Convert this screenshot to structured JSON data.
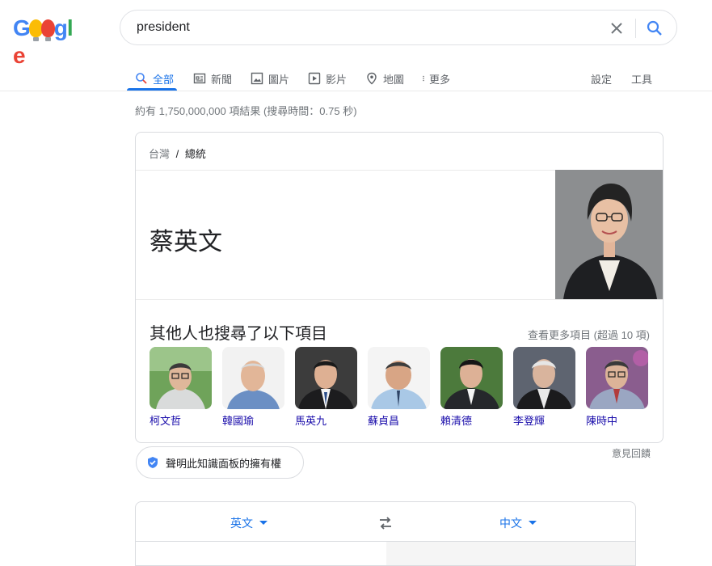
{
  "search": {
    "query": "president"
  },
  "tabs": [
    {
      "label": "全部",
      "icon": "search-icon"
    },
    {
      "label": "新聞",
      "icon": "news-icon"
    },
    {
      "label": "圖片",
      "icon": "image-icon"
    },
    {
      "label": "影片",
      "icon": "video-icon"
    },
    {
      "label": "地圖",
      "icon": "map-pin-icon"
    },
    {
      "label": "更多",
      "icon": "more-vert-icon"
    }
  ],
  "tools": {
    "settings": "設定",
    "tools": "工具"
  },
  "result_stats": "約有 1,750,000,000 項結果 (搜尋時間：0.75 秒)",
  "panel": {
    "breadcrumb": {
      "parent": "台灣",
      "separator": "/",
      "current": "總統"
    },
    "title": "蔡英文",
    "also_search": {
      "heading": "其他人也搜尋了以下項目",
      "see_more": "查看更多項目 (超過 10 項)",
      "people": [
        "柯文哲",
        "韓國瑜",
        "馬英九",
        "蘇貞昌",
        "賴清德",
        "李登輝",
        "陳時中"
      ]
    }
  },
  "feedback": "意見回饋",
  "claim": "聲明此知識面板的擁有權",
  "translate": {
    "source_lang": "英文",
    "target_lang": "中文"
  },
  "colors": {
    "accent": "#1a73e8",
    "link": "#1a0dab"
  }
}
